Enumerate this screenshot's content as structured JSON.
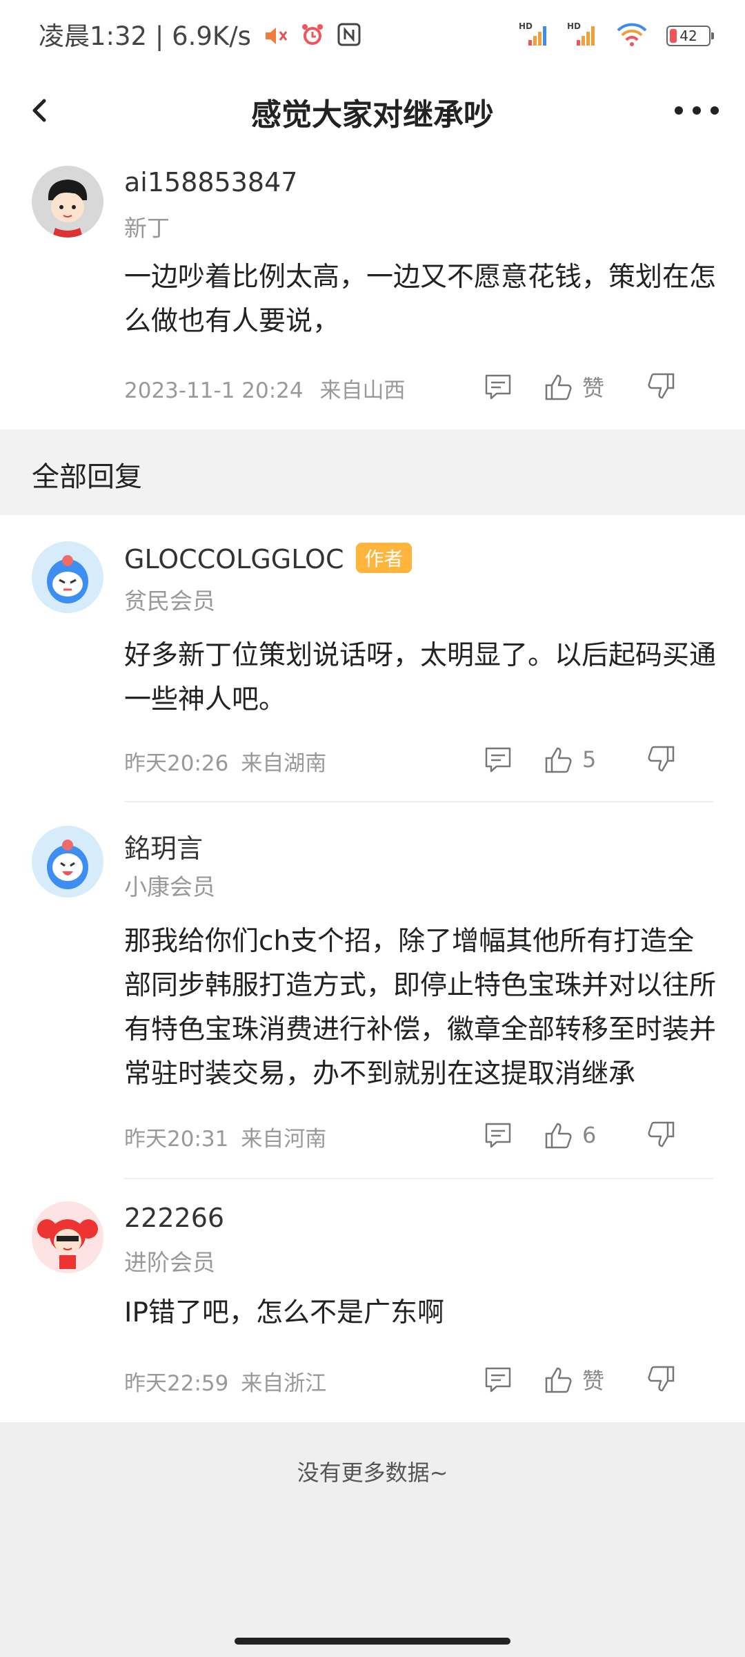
{
  "status_bar": {
    "time": "凌晨1:32",
    "net_speed": "6.9K/s",
    "battery": "42"
  },
  "header": {
    "title": "感觉大家对继承吵"
  },
  "main_comment": {
    "user": "ai158853847",
    "level": "新丁",
    "text": "一边吵着比例太高，一边又不愿意花钱，策划在怎么做也有人要说，",
    "time": "2023-11-1 20:24",
    "location": "来自山西",
    "likes": "赞"
  },
  "section": {
    "title": "全部回复"
  },
  "replies": [
    {
      "user": "GLOCCOLGGLOC",
      "badge": "作者",
      "level": "贫民会员",
      "text": "好多新丁位策划说话呀，太明显了。以后起码买通一些神人吧。",
      "time": "昨天20:26",
      "location": "来自湖南",
      "likes": "5"
    },
    {
      "user": "銘玥言",
      "level": "小康会员",
      "text": "那我给你们ch支个招，除了增幅其他所有打造全部同步韩服打造方式，即停止特色宝珠并对以往所有特色宝珠消费进行补偿，徽章全部转移至时装并常驻时装交易，办不到就别在这提取消继承",
      "time": "昨天20:31",
      "location": "来自河南",
      "likes": "6"
    },
    {
      "user": "222266",
      "level": "进阶会员",
      "text": "IP错了吧，怎么不是广东啊",
      "time": "昨天22:59",
      "location": "来自浙江",
      "likes": "赞"
    }
  ],
  "footer": {
    "no_more": "没有更多数据~"
  },
  "colors": {
    "badge": "#ffb43c",
    "section_bg": "#f2f2f2",
    "meta_text": "#999999"
  },
  "icons": [
    "back-icon",
    "more-icon",
    "comment-icon",
    "thumbs-up-icon",
    "thumbs-down-icon"
  ]
}
